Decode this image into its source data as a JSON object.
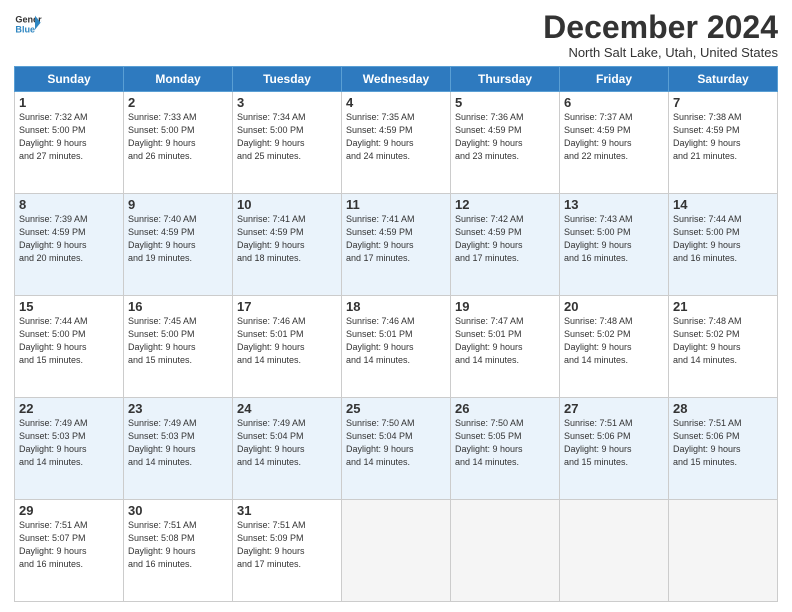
{
  "header": {
    "logo_line1": "General",
    "logo_line2": "Blue",
    "month": "December 2024",
    "location": "North Salt Lake, Utah, United States"
  },
  "weekdays": [
    "Sunday",
    "Monday",
    "Tuesday",
    "Wednesday",
    "Thursday",
    "Friday",
    "Saturday"
  ],
  "weeks": [
    [
      {
        "day": 1,
        "info": "Sunrise: 7:32 AM\nSunset: 5:00 PM\nDaylight: 9 hours\nand 27 minutes."
      },
      {
        "day": 2,
        "info": "Sunrise: 7:33 AM\nSunset: 5:00 PM\nDaylight: 9 hours\nand 26 minutes."
      },
      {
        "day": 3,
        "info": "Sunrise: 7:34 AM\nSunset: 5:00 PM\nDaylight: 9 hours\nand 25 minutes."
      },
      {
        "day": 4,
        "info": "Sunrise: 7:35 AM\nSunset: 4:59 PM\nDaylight: 9 hours\nand 24 minutes."
      },
      {
        "day": 5,
        "info": "Sunrise: 7:36 AM\nSunset: 4:59 PM\nDaylight: 9 hours\nand 23 minutes."
      },
      {
        "day": 6,
        "info": "Sunrise: 7:37 AM\nSunset: 4:59 PM\nDaylight: 9 hours\nand 22 minutes."
      },
      {
        "day": 7,
        "info": "Sunrise: 7:38 AM\nSunset: 4:59 PM\nDaylight: 9 hours\nand 21 minutes."
      }
    ],
    [
      {
        "day": 8,
        "info": "Sunrise: 7:39 AM\nSunset: 4:59 PM\nDaylight: 9 hours\nand 20 minutes."
      },
      {
        "day": 9,
        "info": "Sunrise: 7:40 AM\nSunset: 4:59 PM\nDaylight: 9 hours\nand 19 minutes."
      },
      {
        "day": 10,
        "info": "Sunrise: 7:41 AM\nSunset: 4:59 PM\nDaylight: 9 hours\nand 18 minutes."
      },
      {
        "day": 11,
        "info": "Sunrise: 7:41 AM\nSunset: 4:59 PM\nDaylight: 9 hours\nand 17 minutes."
      },
      {
        "day": 12,
        "info": "Sunrise: 7:42 AM\nSunset: 4:59 PM\nDaylight: 9 hours\nand 17 minutes."
      },
      {
        "day": 13,
        "info": "Sunrise: 7:43 AM\nSunset: 5:00 PM\nDaylight: 9 hours\nand 16 minutes."
      },
      {
        "day": 14,
        "info": "Sunrise: 7:44 AM\nSunset: 5:00 PM\nDaylight: 9 hours\nand 16 minutes."
      }
    ],
    [
      {
        "day": 15,
        "info": "Sunrise: 7:44 AM\nSunset: 5:00 PM\nDaylight: 9 hours\nand 15 minutes."
      },
      {
        "day": 16,
        "info": "Sunrise: 7:45 AM\nSunset: 5:00 PM\nDaylight: 9 hours\nand 15 minutes."
      },
      {
        "day": 17,
        "info": "Sunrise: 7:46 AM\nSunset: 5:01 PM\nDaylight: 9 hours\nand 14 minutes."
      },
      {
        "day": 18,
        "info": "Sunrise: 7:46 AM\nSunset: 5:01 PM\nDaylight: 9 hours\nand 14 minutes."
      },
      {
        "day": 19,
        "info": "Sunrise: 7:47 AM\nSunset: 5:01 PM\nDaylight: 9 hours\nand 14 minutes."
      },
      {
        "day": 20,
        "info": "Sunrise: 7:48 AM\nSunset: 5:02 PM\nDaylight: 9 hours\nand 14 minutes."
      },
      {
        "day": 21,
        "info": "Sunrise: 7:48 AM\nSunset: 5:02 PM\nDaylight: 9 hours\nand 14 minutes."
      }
    ],
    [
      {
        "day": 22,
        "info": "Sunrise: 7:49 AM\nSunset: 5:03 PM\nDaylight: 9 hours\nand 14 minutes."
      },
      {
        "day": 23,
        "info": "Sunrise: 7:49 AM\nSunset: 5:03 PM\nDaylight: 9 hours\nand 14 minutes."
      },
      {
        "day": 24,
        "info": "Sunrise: 7:49 AM\nSunset: 5:04 PM\nDaylight: 9 hours\nand 14 minutes."
      },
      {
        "day": 25,
        "info": "Sunrise: 7:50 AM\nSunset: 5:04 PM\nDaylight: 9 hours\nand 14 minutes."
      },
      {
        "day": 26,
        "info": "Sunrise: 7:50 AM\nSunset: 5:05 PM\nDaylight: 9 hours\nand 14 minutes."
      },
      {
        "day": 27,
        "info": "Sunrise: 7:51 AM\nSunset: 5:06 PM\nDaylight: 9 hours\nand 15 minutes."
      },
      {
        "day": 28,
        "info": "Sunrise: 7:51 AM\nSunset: 5:06 PM\nDaylight: 9 hours\nand 15 minutes."
      }
    ],
    [
      {
        "day": 29,
        "info": "Sunrise: 7:51 AM\nSunset: 5:07 PM\nDaylight: 9 hours\nand 16 minutes."
      },
      {
        "day": 30,
        "info": "Sunrise: 7:51 AM\nSunset: 5:08 PM\nDaylight: 9 hours\nand 16 minutes."
      },
      {
        "day": 31,
        "info": "Sunrise: 7:51 AM\nSunset: 5:09 PM\nDaylight: 9 hours\nand 17 minutes."
      },
      null,
      null,
      null,
      null
    ]
  ]
}
